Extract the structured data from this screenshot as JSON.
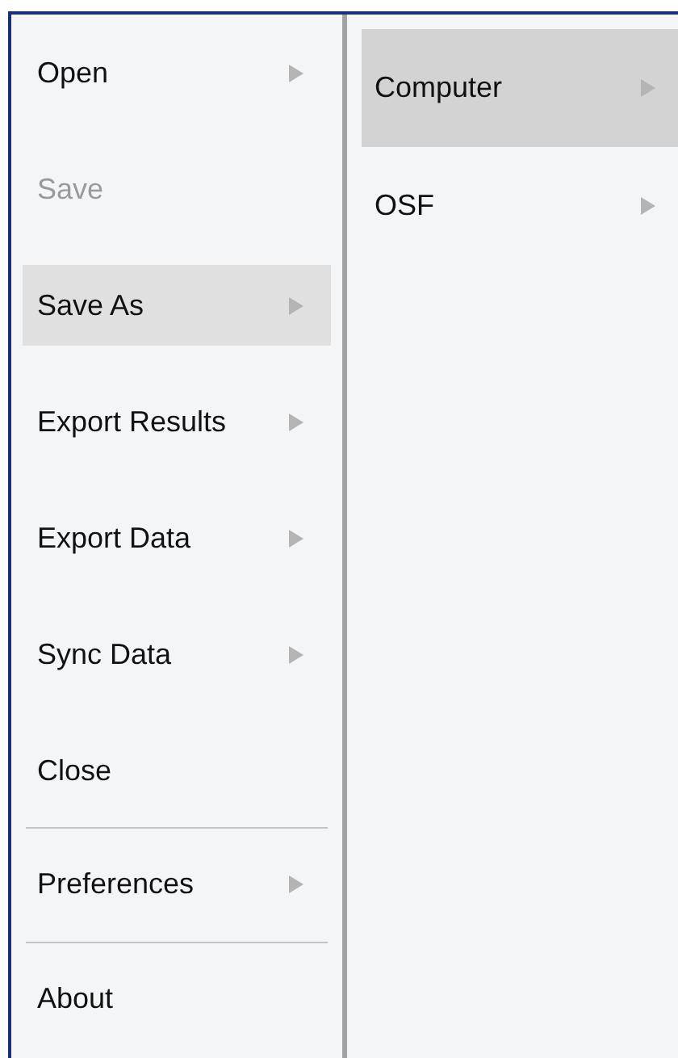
{
  "main_menu": [
    {
      "kind": "item",
      "label": "Open",
      "submenu": true,
      "disabled": false,
      "selected": false
    },
    {
      "kind": "item",
      "label": "Save",
      "submenu": false,
      "disabled": true,
      "selected": false
    },
    {
      "kind": "item",
      "label": "Save As",
      "submenu": true,
      "disabled": false,
      "selected": true
    },
    {
      "kind": "item",
      "label": "Export Results",
      "submenu": true,
      "disabled": false,
      "selected": false
    },
    {
      "kind": "item",
      "label": "Export Data",
      "submenu": true,
      "disabled": false,
      "selected": false
    },
    {
      "kind": "item",
      "label": "Sync Data",
      "submenu": true,
      "disabled": false,
      "selected": false
    },
    {
      "kind": "item",
      "label": "Close",
      "submenu": false,
      "disabled": false,
      "selected": false
    },
    {
      "kind": "separator"
    },
    {
      "kind": "item",
      "label": "Preferences",
      "submenu": true,
      "disabled": false,
      "selected": false
    },
    {
      "kind": "separator"
    },
    {
      "kind": "item",
      "label": "About",
      "submenu": false,
      "disabled": false,
      "selected": false
    }
  ],
  "submenu": [
    {
      "label": "Computer",
      "submenu": true,
      "selected": true
    },
    {
      "label": "OSF",
      "submenu": true,
      "selected": false
    }
  ]
}
